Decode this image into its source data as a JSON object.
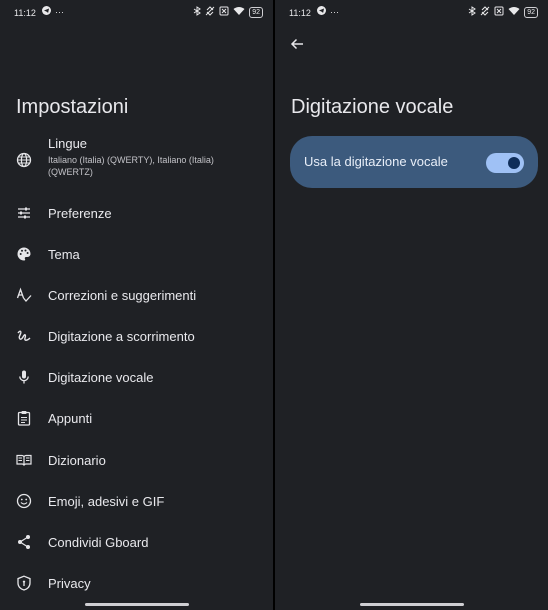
{
  "status": {
    "time": "11:12",
    "more_dots": "···",
    "battery": "92"
  },
  "left": {
    "title": "Impostazioni",
    "items": [
      {
        "label": "Lingue",
        "subtitle": "Italiano (Italia) (QWERTY), Italiano (Italia) (QWERTZ)",
        "icon": "globe-icon"
      },
      {
        "label": "Preferenze",
        "icon": "sliders-icon"
      },
      {
        "label": "Tema",
        "icon": "palette-icon"
      },
      {
        "label": "Correzioni e suggerimenti",
        "icon": "spellcheck-icon"
      },
      {
        "label": "Digitazione a scorrimento",
        "icon": "gesture-icon"
      },
      {
        "label": "Digitazione vocale",
        "icon": "microphone-icon"
      },
      {
        "label": "Appunti",
        "icon": "clipboard-icon"
      },
      {
        "label": "Dizionario",
        "icon": "book-icon"
      },
      {
        "label": "Emoji, adesivi e GIF",
        "icon": "emoji-icon"
      },
      {
        "label": "Condividi Gboard",
        "icon": "share-icon"
      },
      {
        "label": "Privacy",
        "icon": "shield-icon"
      }
    ]
  },
  "right": {
    "title": "Digitazione vocale",
    "toggle_label": "Usa la digitazione vocale",
    "toggle_on": true
  },
  "colors": {
    "background": "#1f2125",
    "card": "#3c5a7d",
    "toggle_track": "#9fc1f5",
    "toggle_knob": "#0f2e5a"
  }
}
